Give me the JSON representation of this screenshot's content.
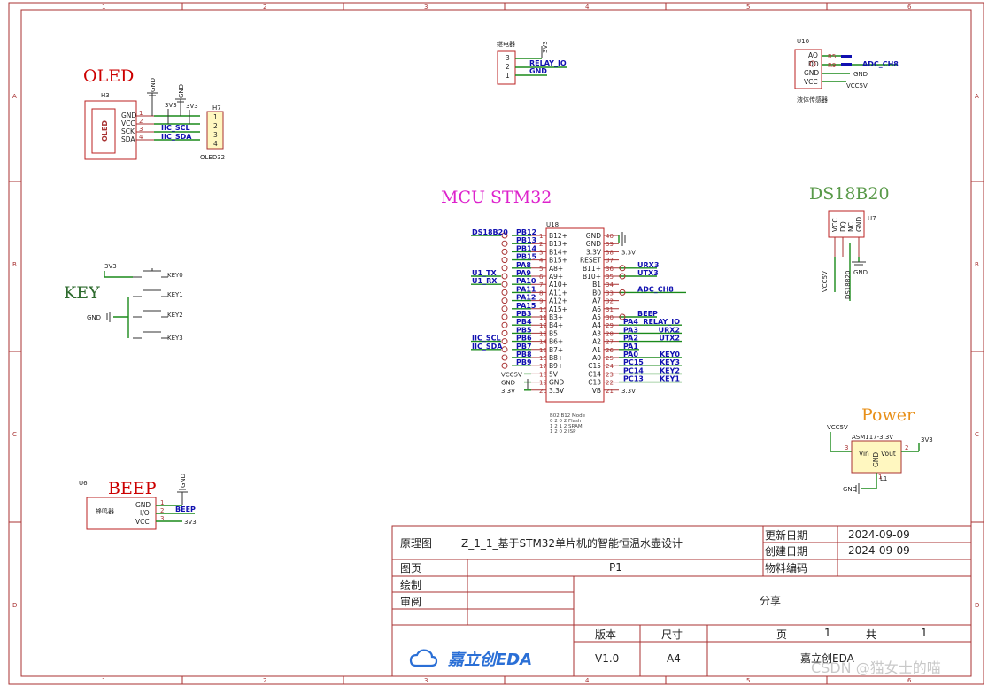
{
  "border": {
    "cols": [
      "1",
      "2",
      "3",
      "4",
      "5",
      "6"
    ],
    "rows": [
      "A",
      "B",
      "C",
      "D"
    ]
  },
  "blocks": {
    "oled": {
      "title": "OLED",
      "ref": "H3",
      "ref2": "H7",
      "body": "OLED",
      "part": "OLED32",
      "pins": [
        "GND",
        "VCC",
        "SCK",
        "SDA"
      ],
      "nums": [
        "1",
        "2",
        "3",
        "4"
      ],
      "nets": [
        "IIC_SCL",
        "IIC_SDA"
      ],
      "pwr_gnd": "GND",
      "pwr_v1": "3V3",
      "pwr_v2": "3V3"
    },
    "key": {
      "title": "KEY",
      "gnd": "GND",
      "vcc": "3V3",
      "keys": [
        "KEY0",
        "KEY1",
        "KEY2",
        "KEY3"
      ]
    },
    "beep": {
      "title": "BEEP",
      "ref": "U6",
      "body": "蜂鸣器",
      "pins": [
        "GND",
        "I/O",
        "VCC"
      ],
      "nums": [
        "1",
        "2",
        "3"
      ],
      "net": "BEEP",
      "gnd": "GND",
      "vcc": "3V3"
    },
    "relay": {
      "title": "继电器",
      "nums": [
        "3",
        "2",
        "1"
      ],
      "nets": [
        "RELAY_IO",
        "GND"
      ],
      "vcc": "3V3"
    },
    "liquid": {
      "ref": "U10",
      "body": "液体传感器",
      "pins": [
        "AO",
        "DO",
        "GND",
        "VCC"
      ],
      "nums": [
        "4",
        "3",
        "2",
        "1"
      ],
      "r1": "R5",
      "r2": "R9",
      "net": "ADC_CH8",
      "gnd": "GND",
      "vcc": "VCC5V"
    },
    "ds18b20": {
      "title": "DS18B20",
      "ref": "U7",
      "pins": [
        "VCC",
        "DQ",
        "NC",
        "GND"
      ],
      "nums": [
        "1",
        "2",
        "3",
        "4"
      ],
      "net": "DS18B20",
      "vcc": "VCC5V",
      "gnd": "GND"
    },
    "power": {
      "title": "Power",
      "part": "ASM117-3.3V",
      "vin": "Vin",
      "vout": "Vout",
      "gndpin": "GND",
      "vcc": "VCC5V",
      "out": "3V3",
      "gnd": "GND",
      "ref": "L1",
      "nums": [
        "3",
        "2",
        "1"
      ]
    }
  },
  "mcu": {
    "title": "MCU STM32",
    "ref": "U18",
    "left_pins": [
      "B12+",
      "B13+",
      "B14+",
      "B15+",
      "A8+",
      "A9+",
      "A10+",
      "A11+",
      "A12+",
      "A15+",
      "B3+",
      "B4+",
      "B5",
      "B6+",
      "B7+",
      "B8+",
      "B9+",
      "5V",
      "GND",
      "3.3V"
    ],
    "left_nums": [
      "1",
      "2",
      "3",
      "4",
      "5",
      "6",
      "7",
      "8",
      "9",
      "10",
      "11",
      "12",
      "13",
      "14",
      "15",
      "16",
      "17",
      "18",
      "19",
      "20"
    ],
    "left_nets": [
      "PB12",
      "PB13",
      "PB14",
      "PB15",
      "PA8",
      "PA9",
      "PA10",
      "PA11",
      "PA12",
      "PA15",
      "PB3",
      "PB4",
      "PB5",
      "PB6",
      "PB7",
      "PB8",
      "PB9",
      "",
      "",
      ""
    ],
    "left_ext": [
      "DS18B20",
      "",
      "",
      "",
      "",
      "U1_TX",
      "U1_RX",
      "",
      "",
      "",
      "",
      "",
      "",
      "IIC_SCL",
      "IIC_SDA",
      "",
      "",
      "VCC5V",
      "GND",
      "3.3V"
    ],
    "right_pins": [
      "GND",
      "GND",
      "3.3V",
      "RESET",
      "B11+",
      "B10+",
      "B1",
      "B0",
      "A7",
      "A6",
      "A5",
      "A4",
      "A3",
      "A2",
      "A1",
      "A0",
      "C15",
      "C14",
      "C13",
      "VB"
    ],
    "right_nums": [
      "40",
      "39",
      "38",
      "37",
      "36",
      "35",
      "34",
      "33",
      "32",
      "31",
      "30",
      "29",
      "28",
      "27",
      "26",
      "25",
      "24",
      "23",
      "22",
      "21"
    ],
    "right_nets": [
      "",
      "",
      "",
      "",
      "",
      "",
      "",
      "",
      "",
      "",
      "",
      "PA4",
      "PA3",
      "PA2",
      "PA1",
      "PA0",
      "PC15",
      "PC14",
      "PC13",
      ""
    ],
    "right_ext": [
      "",
      "",
      "3.3V",
      "",
      "URX3",
      "UTX3",
      "",
      "ADC_CH8",
      "",
      "",
      "BEEP",
      "RELAY_IO",
      "URX2",
      "UTX2",
      "",
      "KEY0",
      "KEY3",
      "KEY2",
      "KEY1",
      "3.3V"
    ],
    "boot_table": [
      "B02 B12 Mode",
      "0  2  0 2  Flash",
      "1  2  1 2  SRAM",
      "1  2  0 2  ISP"
    ]
  },
  "titleblock": {
    "label_schematic": "原理图",
    "title": "Z_1_1_基于STM32单片机的智能恒温水壶设计",
    "label_updated": "更新日期",
    "updated": "2024-09-09",
    "label_created": "创建日期",
    "created": "2024-09-09",
    "label_sheet": "图页",
    "sheet": "P1",
    "label_part": "物料编码",
    "label_draw": "绘制",
    "label_review": "审阅",
    "share": "分享",
    "label_version": "版本",
    "version": "V1.0",
    "label_size": "尺寸",
    "size": "A4",
    "label_page": "页",
    "page": "1",
    "label_total": "共",
    "total": "1",
    "logo_text": "嘉立创EDA",
    "company": "嘉立创EDA"
  },
  "watermark": "CSDN @猫女士的喵",
  "colors": {
    "frame": "#a83232",
    "net": "#1a8a1a",
    "netlabel": "#1010b0",
    "oled_title": "#cc0000",
    "mcu_title": "#dd22cc",
    "key_title": "#2e6b2e",
    "ds_title": "#5a9a4a",
    "power_title": "#e8901a",
    "beep_title": "#cc0000",
    "logo": "#2a6fd6"
  }
}
